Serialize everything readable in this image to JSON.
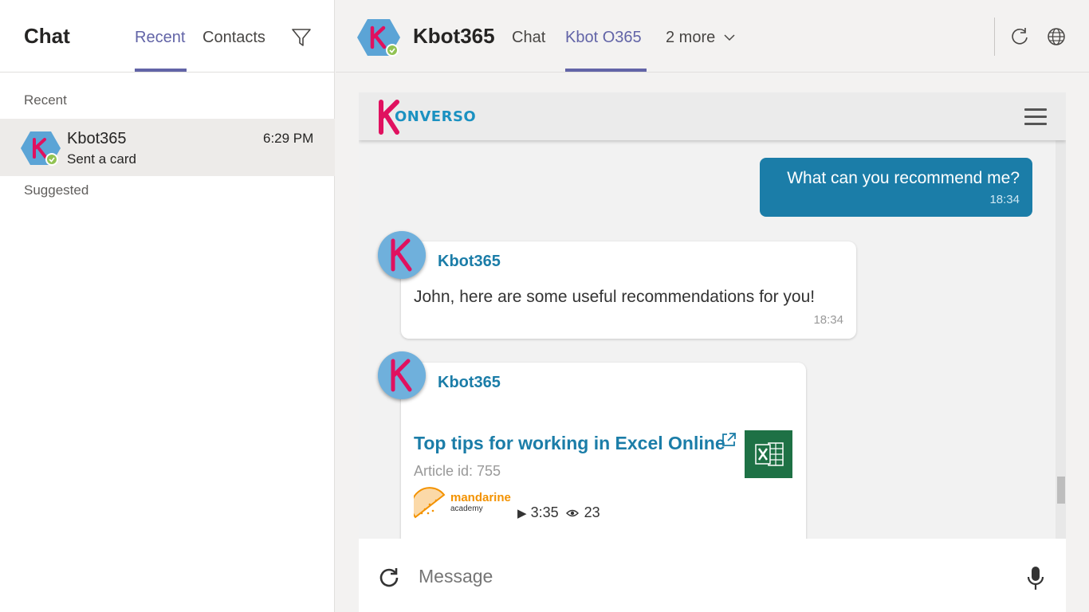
{
  "left_panel": {
    "title": "Chat",
    "tabs": [
      {
        "label": "Recent",
        "active": true
      },
      {
        "label": "Contacts",
        "active": false
      }
    ],
    "filter_icon": "filter-icon",
    "sections": {
      "recent": "Recent",
      "suggested": "Suggested"
    },
    "recent_items": [
      {
        "name": "Kbot365",
        "subtitle": "Sent a card",
        "time": "6:29 PM",
        "status": "online"
      }
    ]
  },
  "header": {
    "bot_name": "Kbot365",
    "tabs": [
      {
        "label": "Chat",
        "active": false
      },
      {
        "label": "Kbot O365",
        "active": true
      },
      {
        "label": "2 more",
        "active": false
      }
    ],
    "icons": [
      "refresh-icon",
      "globe-icon"
    ]
  },
  "webchat": {
    "logo_text": "ONVERSO",
    "messages": [
      {
        "from": "user",
        "text": "What can you recommend me?",
        "time": "18:34"
      },
      {
        "from": "bot",
        "sender": "Kbot365",
        "text": "John, here are some useful recommendations for you!",
        "time": "18:34"
      },
      {
        "from": "bot",
        "sender": "Kbot365",
        "card": {
          "title": "Top tips for working in Excel Online",
          "article_id": "Article id: 755",
          "publisher": "mandarine",
          "publisher_sub": "academy",
          "duration": "3:35",
          "views": "23"
        }
      }
    ],
    "composer": {
      "placeholder": "Message"
    }
  },
  "colors": {
    "teams_accent": "#6264a7",
    "user_bubble": "#1b7da8",
    "bot_name": "#1b7da8",
    "excel_green": "#1e7145",
    "konverso_pink": "#e0115f"
  }
}
